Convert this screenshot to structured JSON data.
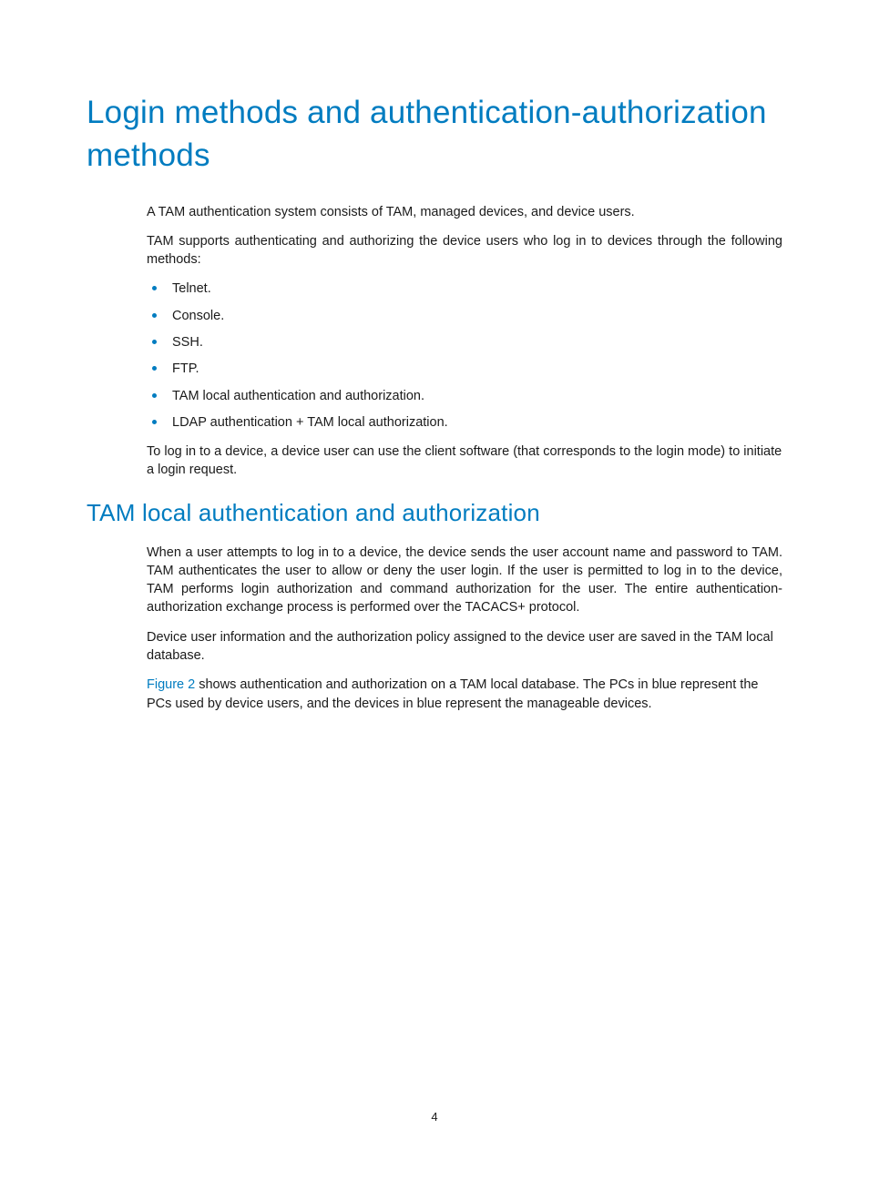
{
  "heading1": "Login methods and authentication-authorization methods",
  "para1": "A TAM authentication system consists of TAM, managed devices, and device users.",
  "para2": "TAM supports authenticating and authorizing the device users who log in to devices through the following methods:",
  "methods": [
    "Telnet.",
    "Console.",
    "SSH.",
    "FTP.",
    "TAM local authentication and authorization.",
    "LDAP authentication + TAM local authorization."
  ],
  "para3": "To log in to a device, a device user can use the client software (that corresponds to the login mode) to initiate a login request.",
  "heading2": "TAM local authentication and authorization",
  "para4": "When a user attempts to log in to a device, the device sends the user account name and password to TAM. TAM authenticates the user to allow or deny the user login. If the user is permitted to log in to the device, TAM performs login authorization and command authorization for the user. The entire authentication-authorization exchange process is performed over the TACACS+ protocol.",
  "para5": "Device user information and the authorization policy assigned to the device user are saved in the TAM local database.",
  "figref": "Figure 2",
  "para6_rest": " shows authentication and authorization on a TAM local database. The PCs in blue represent the PCs used by device users, and the devices in blue represent the manageable devices.",
  "page_number": "4"
}
